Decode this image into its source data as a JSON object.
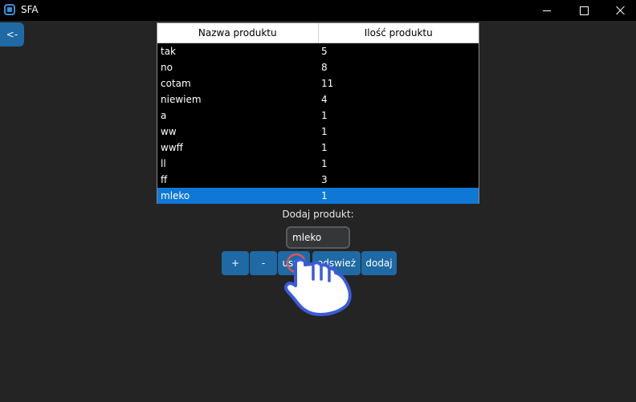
{
  "window": {
    "title": "SFA"
  },
  "back_button": {
    "label": "<-"
  },
  "table": {
    "columns": [
      "Nazwa produktu",
      "Ilość produktu"
    ],
    "rows": [
      {
        "name": "tak",
        "qty": "5"
      },
      {
        "name": "no",
        "qty": "8"
      },
      {
        "name": "cotam",
        "qty": "11"
      },
      {
        "name": "niewiem",
        "qty": "4"
      },
      {
        "name": "a",
        "qty": "1"
      },
      {
        "name": "ww",
        "qty": "1"
      },
      {
        "name": "wwff",
        "qty": "1"
      },
      {
        "name": "ll",
        "qty": "1"
      },
      {
        "name": "ff",
        "qty": "3"
      },
      {
        "name": "mleko",
        "qty": "1"
      }
    ],
    "selected_row": 9
  },
  "form": {
    "label": "Dodaj produkt:",
    "input_value": "mleko"
  },
  "buttons": {
    "plus": "+",
    "minus": "-",
    "delete": "usuń",
    "refresh": "odswież",
    "add": "dodaj"
  },
  "colors": {
    "background": "#242424",
    "accent": "#1f6aa5",
    "selection": "#0f78d7",
    "pointer": "#3b5bdb",
    "click_ring": "#e05555"
  },
  "icons": {
    "app": "app-icon",
    "minimize": "minimize-icon",
    "maximize": "maximize-icon",
    "close": "close-icon",
    "pointer": "hand-pointer-icon"
  }
}
